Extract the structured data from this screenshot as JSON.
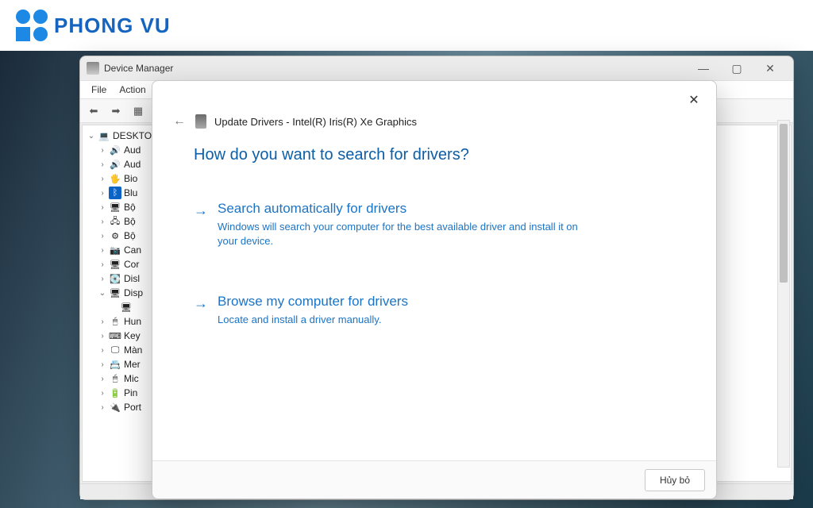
{
  "brand": {
    "name": "PHONG VU"
  },
  "devmgr": {
    "title": "Device Manager",
    "menu": {
      "file": "File",
      "action": "Action"
    },
    "tree": {
      "root": "DESKTO",
      "items": [
        "Aud",
        "Aud",
        "Bio",
        "Blu",
        "Bộ ",
        "Bộ ",
        "Bộ ",
        "Can",
        "Cor",
        "Disl",
        "Disp",
        "",
        "Hun",
        "Key",
        "Màn",
        "Mer",
        "Mic",
        "Pin",
        "Port"
      ]
    }
  },
  "wizard": {
    "breadcrumb": "Update Drivers - Intel(R) Iris(R) Xe Graphics",
    "question": "How do you want to search for drivers?",
    "opt1": {
      "title": "Search automatically for drivers",
      "desc": "Windows will search your computer for the best available driver and install it on your device."
    },
    "opt2": {
      "title": "Browse my computer for drivers",
      "desc": "Locate and install a driver manually."
    },
    "cancel": "Hủy bỏ"
  }
}
